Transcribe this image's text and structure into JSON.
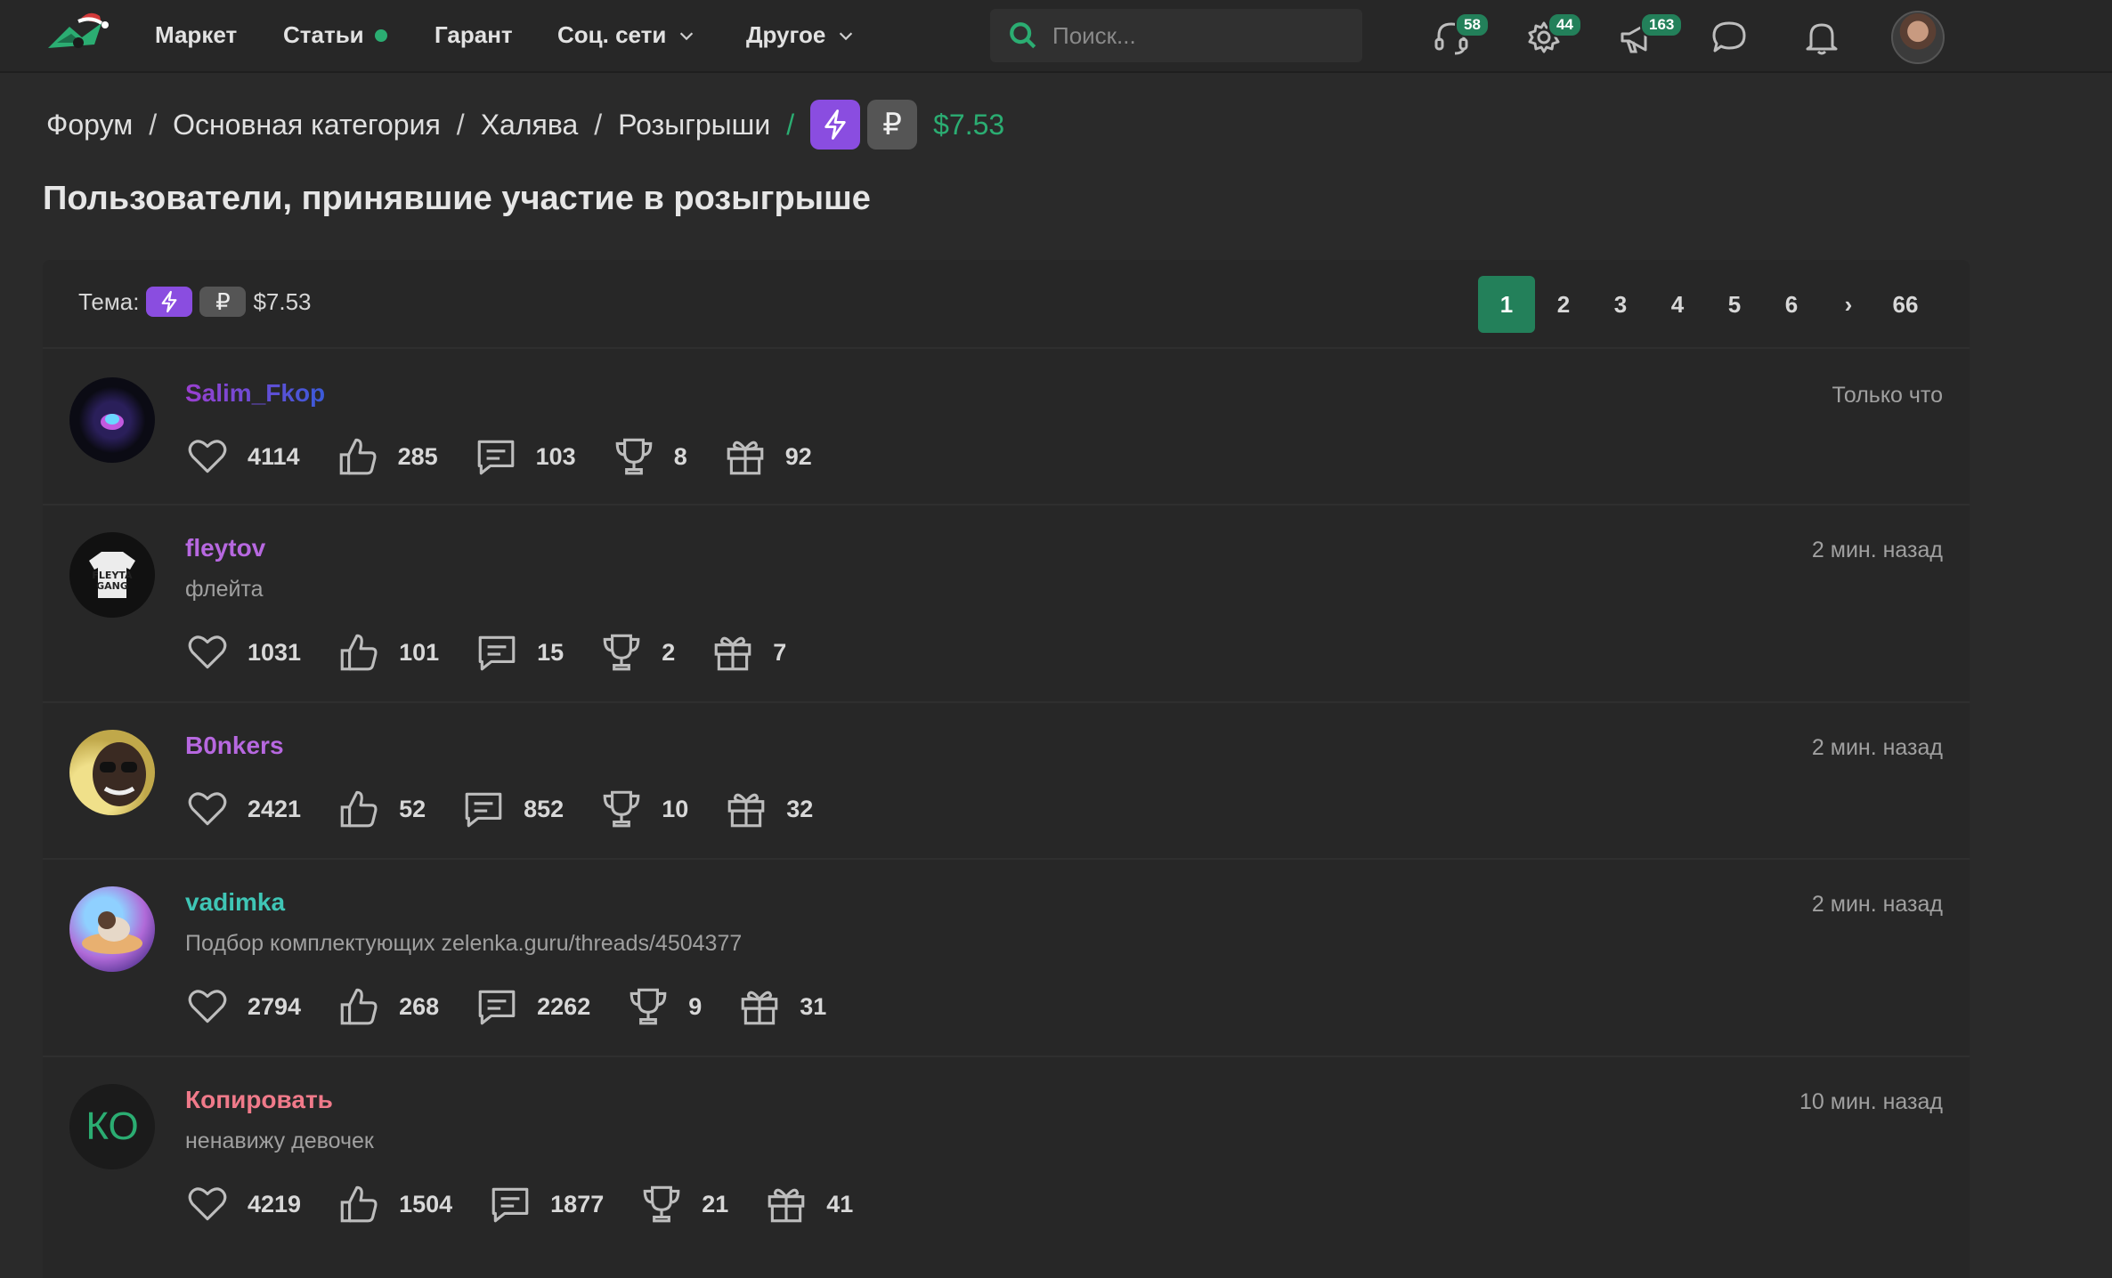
{
  "nav": {
    "items": [
      "Маркет",
      "Статьи",
      "Гарант",
      "Соц. сети",
      "Другое"
    ],
    "search_placeholder": "Поиск...",
    "badges": {
      "support": "58",
      "settings": "44",
      "promo": "163"
    }
  },
  "breadcrumb": {
    "items": [
      "Форум",
      "Основная категория",
      "Халява",
      "Розыгрыши"
    ],
    "ruble_prefix": "₽",
    "price": "$7.53"
  },
  "page": {
    "title": "Пользователи, принявшие участие в розыгрыше"
  },
  "topic": {
    "label": "Тема:",
    "ruble_prefix": "₽",
    "price": "$7.53"
  },
  "pagination": {
    "pages": [
      "1",
      "2",
      "3",
      "4",
      "5",
      "6"
    ],
    "next": "›",
    "last": "66",
    "current": "1"
  },
  "participants": [
    {
      "name": "Salim_Fkop",
      "status": "",
      "time": "Только что",
      "likes": "4114",
      "thumbs": "285",
      "messages": "103",
      "trophies": "8",
      "gifts": "92"
    },
    {
      "name": "fleytov",
      "status": "флейта",
      "time": "2 мин. назад",
      "likes": "1031",
      "thumbs": "101",
      "messages": "15",
      "trophies": "2",
      "gifts": "7"
    },
    {
      "name": "B0nkers",
      "status": "",
      "time": "2 мин. назад",
      "likes": "2421",
      "thumbs": "52",
      "messages": "852",
      "trophies": "10",
      "gifts": "32"
    },
    {
      "name": "vadimka",
      "status": "Подбор комплектующих zelenka.guru/threads/4504377",
      "time": "2 мин. назад",
      "likes": "2794",
      "thumbs": "268",
      "messages": "2262",
      "trophies": "9",
      "gifts": "31"
    },
    {
      "name": "Копировать",
      "status": "ненавижу девочек",
      "time": "10 мин. назад",
      "likes": "4219",
      "thumbs": "1504",
      "messages": "1877",
      "trophies": "21",
      "gifts": "41",
      "avatar_initials": "КО"
    }
  ],
  "colors": {
    "accent_green": "#2bad72",
    "active_page": "#23805a",
    "prefix_purple": "#8a4de0",
    "name_purple": "#b768e0",
    "name_teal": "#3fc6b6",
    "name_pink": "#f07a8a"
  }
}
